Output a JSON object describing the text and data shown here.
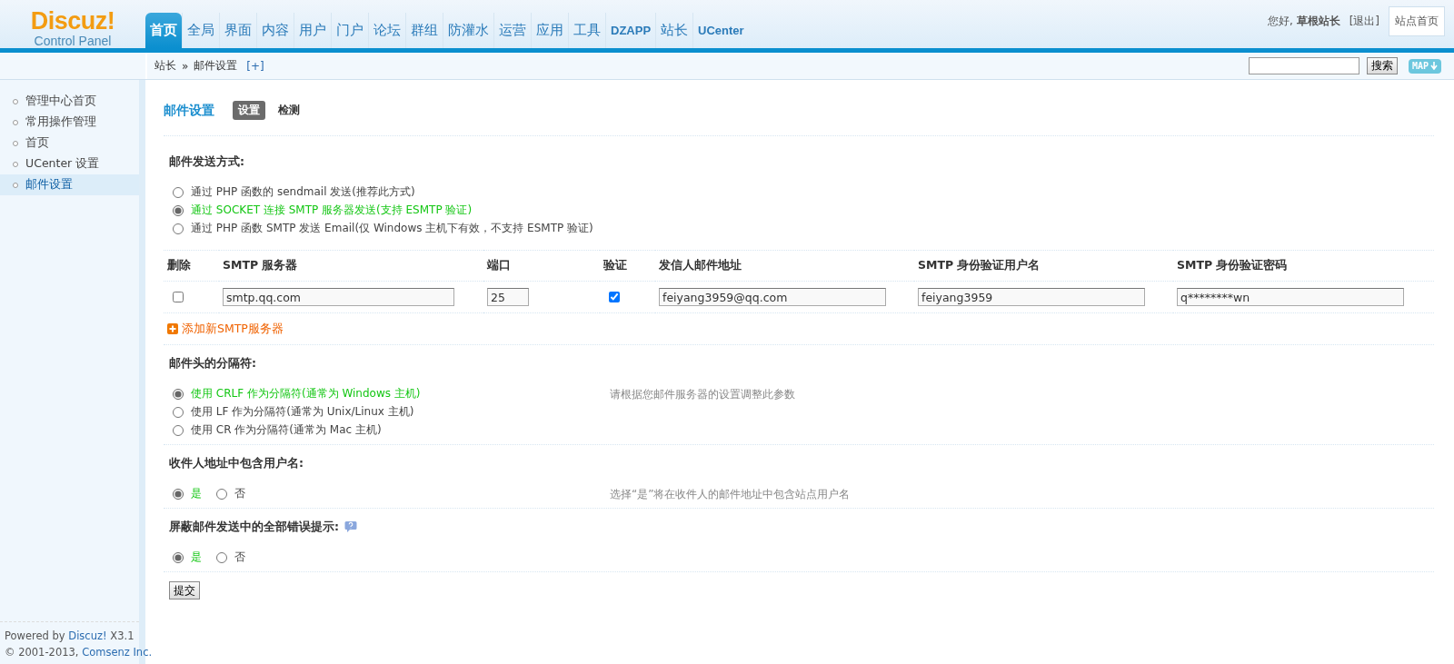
{
  "logo": {
    "title": "Discuz!",
    "subtitle": "Control Panel"
  },
  "nav": [
    {
      "label": "首页",
      "selected": true
    },
    {
      "label": "全局",
      "selected": false
    },
    {
      "label": "界面",
      "selected": false
    },
    {
      "label": "内容",
      "selected": false
    },
    {
      "label": "用户",
      "selected": false
    },
    {
      "label": "门户",
      "selected": false
    },
    {
      "label": "论坛",
      "selected": false
    },
    {
      "label": "群组",
      "selected": false
    },
    {
      "label": "防灌水",
      "selected": false
    },
    {
      "label": "运营",
      "selected": false
    },
    {
      "label": "应用",
      "selected": false
    },
    {
      "label": "工具",
      "selected": false
    },
    {
      "label": "DZAPP",
      "selected": false
    },
    {
      "label": "站长",
      "selected": false
    },
    {
      "label": "UCenter",
      "selected": false
    }
  ],
  "user": {
    "greeting": "您好,",
    "name": "草根站长",
    "logout": "[退出]",
    "site_button": "站点首页"
  },
  "breadcrumb": {
    "items": [
      "站长",
      "邮件设置"
    ],
    "separator": "»",
    "add": "[+]"
  },
  "search": {
    "button": "搜索",
    "map_button": "MAP"
  },
  "sidebar": {
    "items": [
      {
        "label": "管理中心首页",
        "selected": false
      },
      {
        "label": "常用操作管理",
        "selected": false
      },
      {
        "label": "首页",
        "selected": false
      },
      {
        "label": "UCenter 设置",
        "selected": false
      },
      {
        "label": "邮件设置",
        "selected": true
      }
    ]
  },
  "footer": [
    {
      "before": "Powered by ",
      "link": "Discuz!",
      "after": " X3.1"
    },
    {
      "before": "© 2001-2013, ",
      "link": "Comsenz Inc."
    }
  ],
  "page": {
    "title": "邮件设置",
    "tabs": [
      {
        "label": "设置",
        "selected": true
      },
      {
        "label": "检测",
        "selected": false
      }
    ]
  },
  "send_method": {
    "title": "邮件发送方式:",
    "options": [
      {
        "label": "通过 PHP 函数的 sendmail 发送(推荐此方式)",
        "selected": false
      },
      {
        "label": "通过 SOCKET 连接 SMTP 服务器发送(支持 ESMTP 验证)",
        "selected": true
      },
      {
        "label": "通过 PHP 函数 SMTP 发送 Email(仅 Windows 主机下有效，不支持 ESMTP 验证)",
        "selected": false
      }
    ]
  },
  "servers": {
    "columns": [
      "删除",
      "SMTP 服务器",
      "端口",
      "验证",
      "发信人邮件地址",
      "SMTP 身份验证用户名",
      "SMTP 身份验证密码"
    ],
    "rows": [
      {
        "delete": false,
        "server": "smtp.qq.com",
        "port": "25",
        "auth": true,
        "from": "feiyang3959@qq.com",
        "username": "feiyang3959",
        "password": "q********wn"
      }
    ],
    "add_link": "添加新SMTP服务器"
  },
  "sections": [
    {
      "kind": "list",
      "title": "邮件头的分隔符:",
      "help": false,
      "hint": "请根据您邮件服务器的设置调整此参数",
      "options": [
        {
          "label": "使用 CRLF 作为分隔符(通常为 Windows 主机)",
          "selected": true
        },
        {
          "label": "使用 LF 作为分隔符(通常为 Unix/Linux 主机)",
          "selected": false
        },
        {
          "label": "使用 CR 作为分隔符(通常为 Mac 主机)",
          "selected": false
        }
      ]
    },
    {
      "kind": "inline",
      "title": "收件人地址中包含用户名:",
      "help": false,
      "hint": "选择“是”将在收件人的邮件地址中包含站点用户名",
      "options": [
        {
          "label": "是",
          "selected": true
        },
        {
          "label": "否",
          "selected": false
        }
      ]
    },
    {
      "kind": "inline",
      "title": "屏蔽邮件发送中的全部错误提示:",
      "help": true,
      "options": [
        {
          "label": "是",
          "selected": true
        },
        {
          "label": "否",
          "selected": false
        }
      ]
    }
  ],
  "submit": "提交"
}
